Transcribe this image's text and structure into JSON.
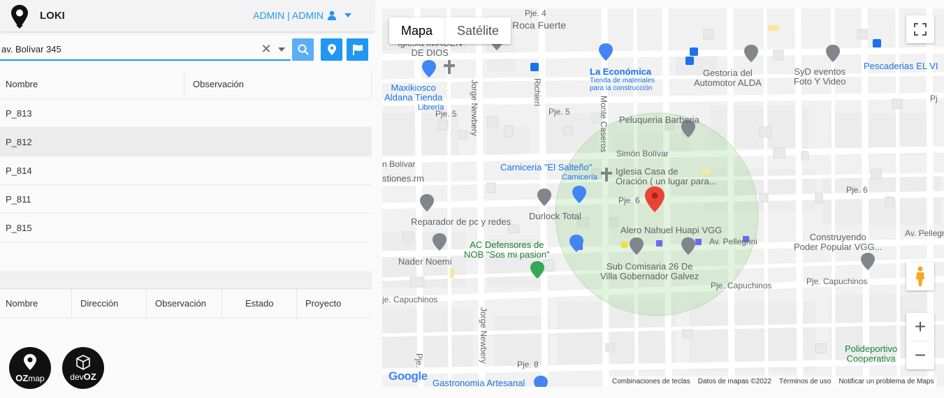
{
  "app": {
    "name": "LOKI",
    "user_label": "ADMIN | ADMIN"
  },
  "search": {
    "value": "av. Bolívar 345",
    "clear_symbol": "✕"
  },
  "table_points": {
    "headers": [
      "Nombre",
      "Observación"
    ],
    "rows": [
      "P_813",
      "P_812",
      "P_814",
      "P_811",
      "P_815"
    ],
    "selected_index": 1
  },
  "table_details": {
    "headers": [
      "Nombre",
      "Dirección",
      "Observación",
      "Estado",
      "Proyecto"
    ]
  },
  "badges": {
    "ozmap_oz": "OZ",
    "ozmap_map": "map",
    "devoz_dev": "dev",
    "devoz_oz": "OZ"
  },
  "map": {
    "type_buttons": [
      "Mapa",
      "Satélite"
    ],
    "active_type": "Mapa",
    "zoom_in": "+",
    "zoom_out": "−",
    "google": "Google",
    "attribution": [
      "Combinaciones de teclas",
      "Datos de mapas ©2022",
      "Términos de uso",
      "Notificar un problema de Maps"
    ],
    "streets": {
      "pje4": "Pje. 4",
      "roca": "Roca Fuerte",
      "pje5a": "Pje. 5",
      "pje5b": "Pje. 5",
      "simon": "Simón Bolívar",
      "bolivar_left": "n Bolívar",
      "pje6a": "Pje. 6",
      "pje6b": "Pje. 6",
      "pellegrini_a": "Av. Pellegrini",
      "pellegrini_b": "Av. Pellegrin",
      "capuchinos_a": "je. Capuchinos",
      "capuchinos_b": "Pje. Capuchinos",
      "capuchinos_c": "Pje. Capuchinos",
      "pje8": "Pje. 8",
      "pje_v": "Pje.",
      "jorge_a": "Jorge Newbery",
      "jorge_b": "Jorge Newbery",
      "richieri": "Richieri",
      "monte": "Monte Caseros",
      "pj_right": "Pj"
    },
    "pois": {
      "imagen": "Iglesia IMAGEN\nDE DIOS",
      "maxikiosco": "Maxikiosco\nAldana Tienda",
      "maxikiosco_sub": "Librería",
      "economica": "La Económica",
      "economica_sub": "Tienda de materiales\npara la construcción",
      "gestoria": "Gestoría del\nAutomotor ALDA",
      "syd": "SyD eventos\nFoto Y Video",
      "pescaderias": "Pescaderias EL VI",
      "peluqueria": "Peluqueria Barberia",
      "carniceria": "Carniceria \"El Salteño\"",
      "carniceria_sub": "Carnicería",
      "iglesia_casa": "Iglesia Casa de\nOración ( un lugar para...",
      "stiones": "stiones.rm",
      "reparador": "Reparador de pc y redes",
      "durlock": "Durlock Total",
      "alero": "Alero Nahuel Huapi VGG",
      "ac_def": "AC Defensores de\nNOB \"Sos mi pasion\"",
      "nader": "Nader Noemi",
      "comisaria": "Sub Comisaria 26 De\nVilla Gobernador Galvez",
      "construyendo": "Construyendo\nPoder Popular VGG...",
      "polideportivo": "Polideportivo\nCooperativa",
      "gastronomia": "Gastronomia Artesanal"
    }
  }
}
